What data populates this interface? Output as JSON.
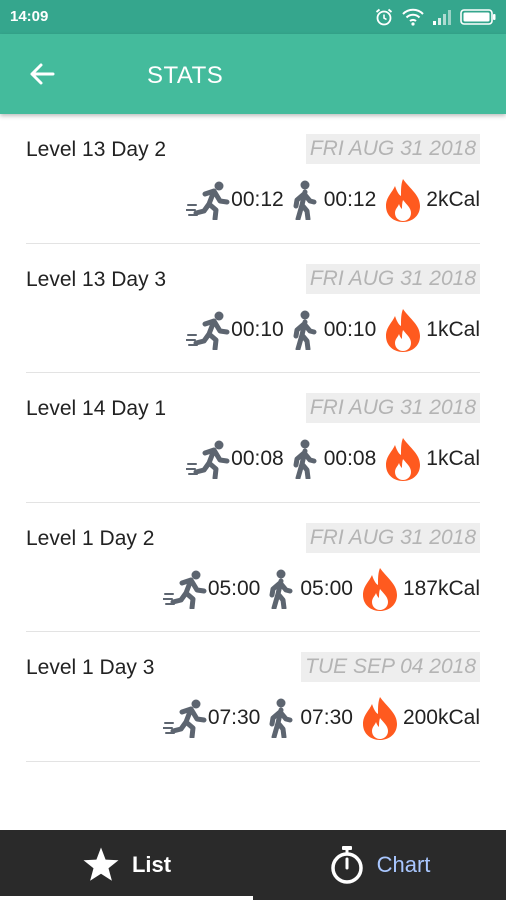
{
  "status_bar": {
    "time": "14:09"
  },
  "app_bar": {
    "title": "STATS"
  },
  "entries": [
    {
      "title": "Level 13 Day 2",
      "date": "FRI AUG 31 2018",
      "run_time": "00:12",
      "walk_time": "00:12",
      "calories": "2kCal"
    },
    {
      "title": "Level 13 Day 3",
      "date": "FRI AUG 31 2018",
      "run_time": "00:10",
      "walk_time": "00:10",
      "calories": "1kCal"
    },
    {
      "title": "Level 14 Day 1",
      "date": "FRI AUG 31 2018",
      "run_time": "00:08",
      "walk_time": "00:08",
      "calories": "1kCal"
    },
    {
      "title": "Level 1 Day 2",
      "date": "FRI AUG 31 2018",
      "run_time": "05:00",
      "walk_time": "05:00",
      "calories": "187kCal"
    },
    {
      "title": "Level 1 Day 3",
      "date": "TUE SEP 04 2018",
      "run_time": "07:30",
      "walk_time": "07:30",
      "calories": "200kCal"
    }
  ],
  "bottom_nav": {
    "list_label": "List",
    "chart_label": "Chart"
  },
  "icons": {
    "run": "running-person-icon",
    "walk": "walking-person-icon",
    "calories": "fire-icon",
    "list": "star-icon",
    "chart": "stopwatch-icon"
  },
  "colors": {
    "status_bar": "#35a68d",
    "app_bar": "#44bb9c",
    "icon_gray": "#5d6570",
    "fire": "#ff5a1f",
    "nav_bg": "#2a2a2a",
    "nav_inactive": "#a9c7ff"
  }
}
